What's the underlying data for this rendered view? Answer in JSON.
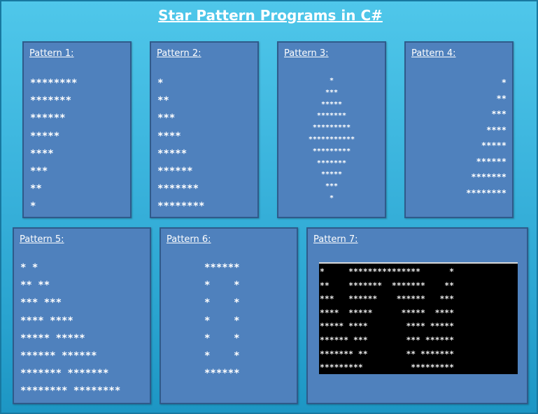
{
  "title": "Star Pattern Programs in C#",
  "patterns": [
    {
      "label": "Pattern 1:",
      "lines": [
        "********",
        "*******",
        "******",
        "*****",
        "****",
        "***",
        "**",
        "*"
      ]
    },
    {
      "label": "Pattern 2:",
      "lines": [
        "*",
        "**",
        "***",
        "****",
        "*****",
        "******",
        "*******",
        "********"
      ]
    },
    {
      "label": "Pattern 3:",
      "lines": [
        "*",
        "***",
        "*****",
        "*******",
        "*********",
        "***********",
        "*********",
        "*******",
        "*****",
        "***",
        "*"
      ]
    },
    {
      "label": "Pattern 4:",
      "lines": [
        "*",
        "**",
        "***",
        "****",
        "*****",
        "******",
        "*******",
        "********"
      ]
    },
    {
      "label": "Pattern 5:",
      "lines": [
        "* *",
        "** **",
        "*** ***",
        "**** ****",
        "***** *****",
        "****** ******",
        "******* *******",
        "******** ********"
      ]
    },
    {
      "label": "Pattern 6:",
      "lines": [
        "******",
        "*    *",
        "*    *",
        "*    *",
        "*    *",
        "*    *",
        "******"
      ]
    },
    {
      "label": "Pattern 7:",
      "lines": [
        "*     ***************      *",
        "**    *******  *******    **",
        "***   ******    ******   ***",
        "****  *****      *****  ****",
        "***** ****        **** *****",
        "****** ***        *** ******",
        "******* **        ** *******",
        "*********          *********"
      ]
    }
  ]
}
